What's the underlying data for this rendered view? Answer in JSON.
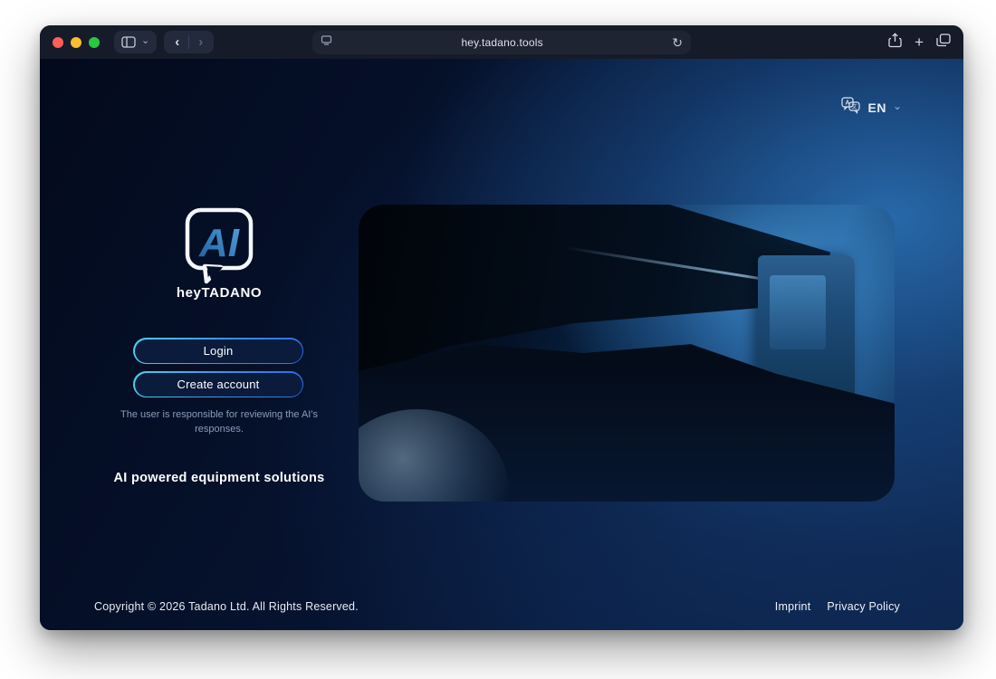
{
  "browser": {
    "url": "hey.tadano.tools",
    "back_glyph": "‹",
    "forward_glyph": "›",
    "sidebar_chevron_glyph": "⌄",
    "refresh_glyph": "↻",
    "plus_glyph": "+"
  },
  "header": {
    "language": {
      "code": "EN",
      "chevron_glyph": "⌄"
    }
  },
  "branding": {
    "logo_letters": "AI",
    "app_name": "heyTADANO",
    "tagline": "AI powered equipment solutions"
  },
  "auth": {
    "login_label": "Login",
    "create_account_label": "Create account",
    "disclaimer": "The user is responsible for reviewing the AI's responses."
  },
  "hero": {
    "description": "crane-photo"
  },
  "footer": {
    "copyright": "Copyright © 2026 Tadano Ltd. All Rights Reserved.",
    "links": [
      {
        "label": "Imprint"
      },
      {
        "label": "Privacy Policy"
      }
    ]
  },
  "colors": {
    "accent_cyan": "#4fd0e8",
    "accent_blue": "#2f6fe0",
    "logo_blue": "#3a8fd0",
    "page_base": "#06122e",
    "glow_blue": "#2c74b9",
    "titlebar_bg": "#161b2a",
    "traffic_red": "#ff5f57",
    "traffic_yellow": "#febc2e",
    "traffic_green": "#28c840"
  }
}
